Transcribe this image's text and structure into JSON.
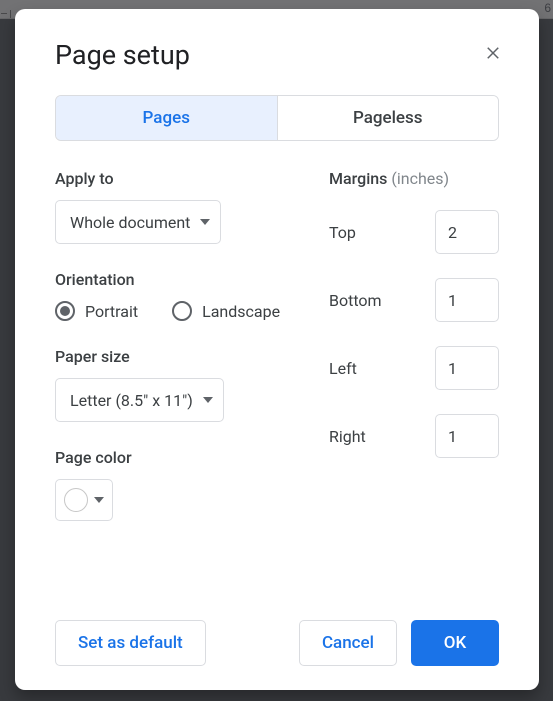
{
  "background": {
    "partial_number": "6"
  },
  "dialog": {
    "title": "Page setup",
    "tabs": {
      "pages": "Pages",
      "pageless": "Pageless"
    },
    "apply_to": {
      "label": "Apply to",
      "value": "Whole document"
    },
    "orientation": {
      "label": "Orientation",
      "portrait": "Portrait",
      "landscape": "Landscape",
      "selected": "portrait"
    },
    "paper_size": {
      "label": "Paper size",
      "value": "Letter (8.5\" x 11\")"
    },
    "page_color": {
      "label": "Page color",
      "value": "#ffffff"
    },
    "margins": {
      "label": "Margins",
      "unit": "(inches)",
      "top_label": "Top",
      "bottom_label": "Bottom",
      "left_label": "Left",
      "right_label": "Right",
      "top": "2",
      "bottom": "1",
      "left": "1",
      "right": "1"
    },
    "buttons": {
      "set_default": "Set as default",
      "cancel": "Cancel",
      "ok": "OK"
    }
  }
}
